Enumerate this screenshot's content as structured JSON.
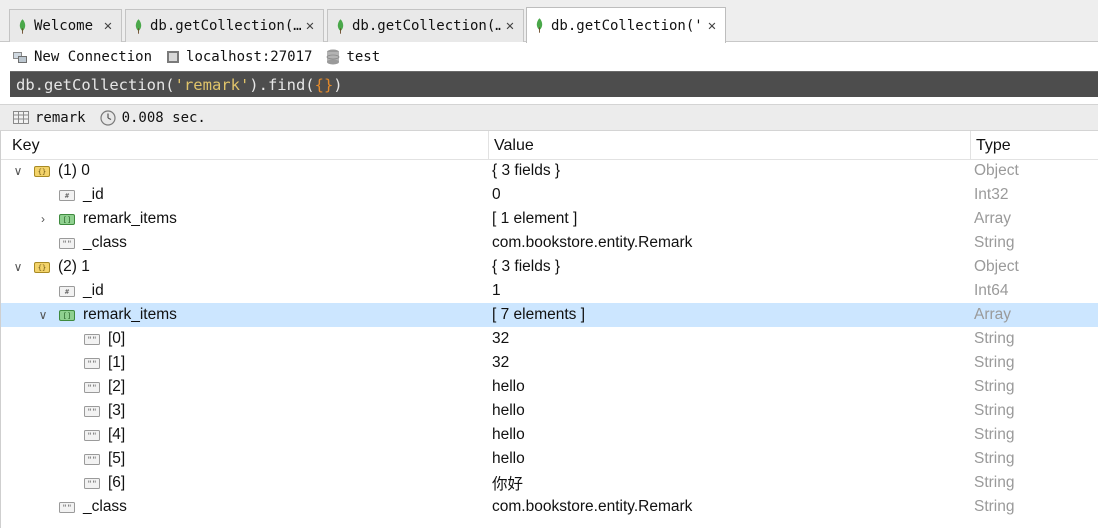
{
  "tabs": [
    {
      "label": "Welcome",
      "active": false
    },
    {
      "label": "db.getCollection(…",
      "active": false
    },
    {
      "label": "db.getCollection(…",
      "active": false
    },
    {
      "label": "db.getCollection('…",
      "active": true
    }
  ],
  "connection": {
    "name": "New Connection",
    "server": "localhost:27017",
    "database": "test"
  },
  "query": {
    "prefix": "db.getCollection(",
    "string": "'remark'",
    "mid": ").find(",
    "braces": "{}",
    "suffix": ")"
  },
  "result": {
    "collection": "remark",
    "time": "0.008 sec."
  },
  "columns": {
    "key": "Key",
    "value": "Value",
    "type": "Type"
  },
  "rows": [
    {
      "key": "(1) 0",
      "value": "{ 3 fields }",
      "type": "Object"
    },
    {
      "key": "_id",
      "value": "0",
      "type": "Int32"
    },
    {
      "key": "remark_items",
      "value": "[ 1 element ]",
      "type": "Array"
    },
    {
      "key": "_class",
      "value": "com.bookstore.entity.Remark",
      "type": "String"
    },
    {
      "key": "(2) 1",
      "value": "{ 3 fields }",
      "type": "Object"
    },
    {
      "key": "_id",
      "value": "1",
      "type": "Int64"
    },
    {
      "key": "remark_items",
      "value": "[ 7 elements ]",
      "type": "Array"
    },
    {
      "key": "[0]",
      "value": "32",
      "type": "String"
    },
    {
      "key": "[1]",
      "value": "32",
      "type": "String"
    },
    {
      "key": "[2]",
      "value": "hello",
      "type": "String"
    },
    {
      "key": "[3]",
      "value": "hello",
      "type": "String"
    },
    {
      "key": "[4]",
      "value": "hello",
      "type": "String"
    },
    {
      "key": "[5]",
      "value": "hello",
      "type": "String"
    },
    {
      "key": "[6]",
      "value": "你好",
      "type": "String"
    },
    {
      "key": "_class",
      "value": "com.bookstore.entity.Remark",
      "type": "String"
    }
  ],
  "icons": {
    "tab": "mongo-leaf-icon",
    "connection": "connection-icon",
    "server": "server-icon",
    "database": "database-icon",
    "collection": "collection-table-icon",
    "time": "clock-icon",
    "object": "object-icon",
    "array": "array-icon",
    "number": "number-icon",
    "string": "string-icon"
  },
  "colors": {
    "leaf": "#4aa84a",
    "query_bg": "#4d4d4d",
    "query_string": "#e0c46a",
    "query_brace": "#e48a2b",
    "selected_row": "#cce6ff",
    "type_text": "#9a9a9a"
  }
}
